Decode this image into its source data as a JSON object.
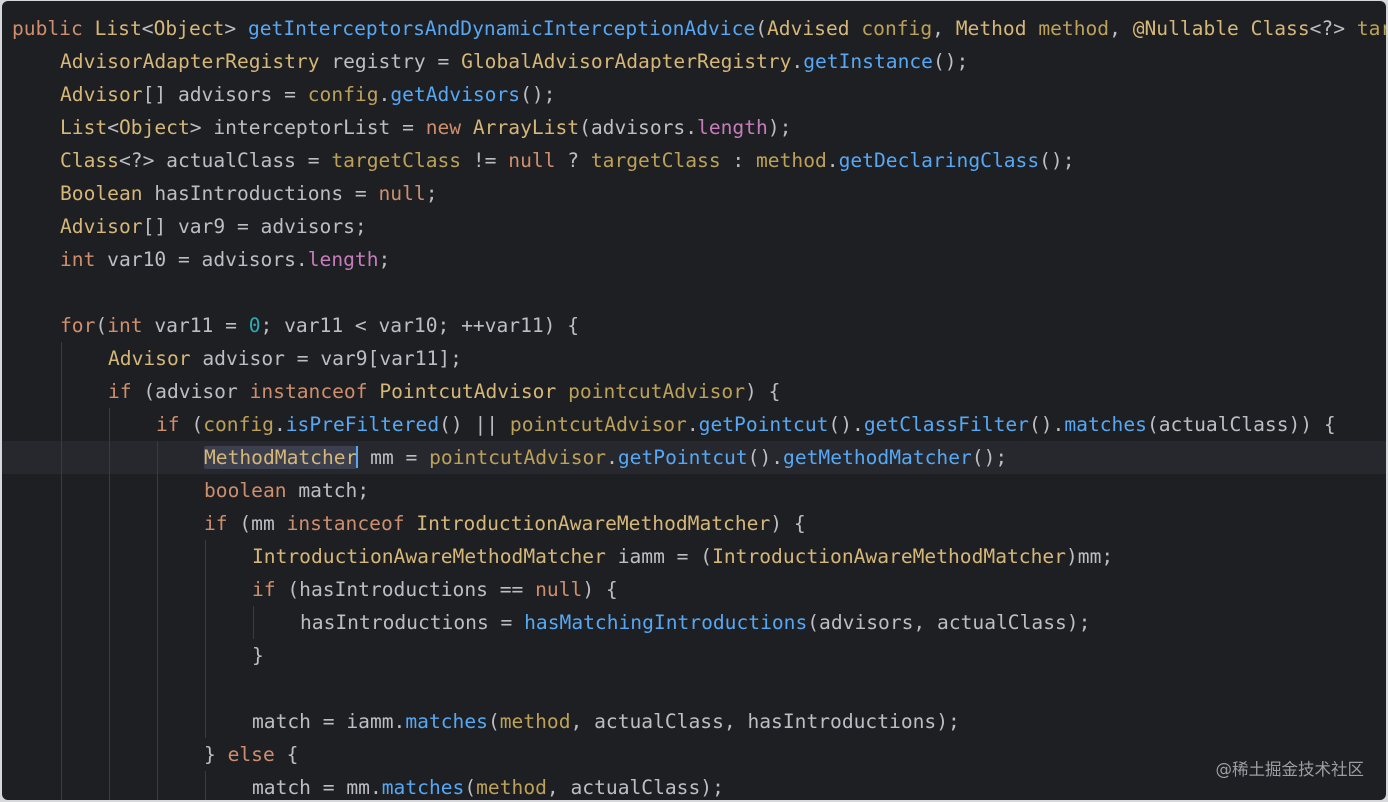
{
  "editor": {
    "lines": [
      "public List<Object> getInterceptorsAndDynamicInterceptionAdvice(Advised config, Method method, @Nullable Class<?> targetClass) {",
      "AdvisorAdapterRegistry registry = GlobalAdvisorAdapterRegistry.getInstance();",
      "Advisor[] advisors = config.getAdvisors();",
      "List<Object> interceptorList = new ArrayList(advisors.length);",
      "Class<?> actualClass = targetClass != null ? targetClass : method.getDeclaringClass();",
      "Boolean hasIntroductions = null;",
      "Advisor[] var9 = advisors;",
      "int var10 = advisors.length;",
      "",
      "for(int var11 = 0; var11 < var10; ++var11) {",
      "Advisor advisor = var9[var11];",
      "if (advisor instanceof PointcutAdvisor pointcutAdvisor) {",
      "if (config.isPreFiltered() || pointcutAdvisor.getPointcut().getClassFilter().matches(actualClass)) {",
      "MethodMatcher mm = pointcutAdvisor.getPointcut().getMethodMatcher();",
      "boolean match;",
      "if (mm instanceof IntroductionAwareMethodMatcher) {",
      "IntroductionAwareMethodMatcher iamm = (IntroductionAwareMethodMatcher)mm;",
      "if (hasIntroductions == null) {",
      "hasIntroductions = hasMatchingIntroductions(advisors, actualClass);",
      "}",
      "",
      "match = iamm.matches(method, actualClass, hasIntroductions);",
      "} else {",
      "match = mm.matches(method, actualClass);"
    ],
    "current_line_index": 13
  },
  "watermark": "@稀土掘金技术社区",
  "colors": {
    "background": "#1e1f22",
    "keyword": "#cf8e6d",
    "type": "#d5b778",
    "method": "#56a8f5",
    "field": "#c77dbb",
    "parameter": "#bca158",
    "number": "#2aacb8",
    "text": "#bcbec4"
  }
}
